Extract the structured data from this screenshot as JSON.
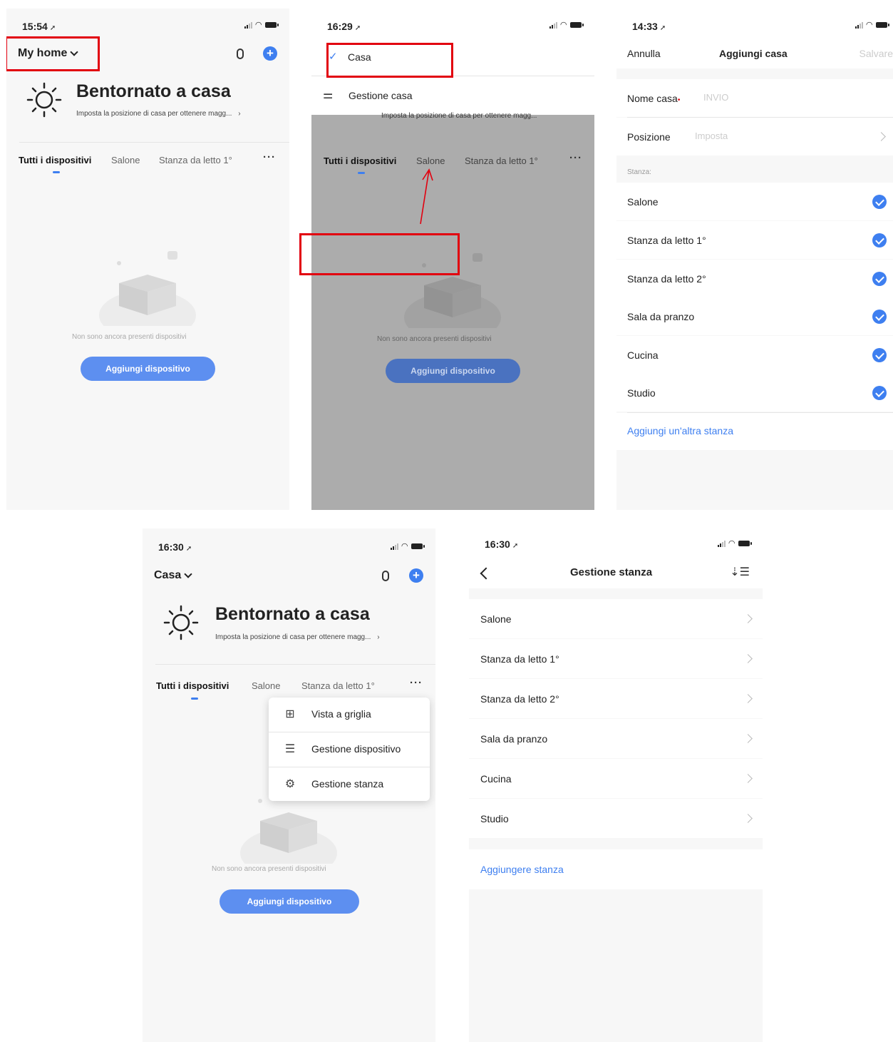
{
  "screen1": {
    "time": "15:54",
    "home_title": "My home",
    "welcome": "Bentornato a casa",
    "subtitle": "Imposta la posizione di casa per ottenere magg...",
    "tabs": [
      "Tutti i dispositivi",
      "Salone",
      "Stanza da letto 1°"
    ],
    "empty_text": "Non sono ancora presenti dispositivi",
    "add_button": "Aggiungi dispositivo"
  },
  "screen2": {
    "time": "16:29",
    "menu_items": [
      "Casa",
      "Gestione casa"
    ],
    "subtitle": "Imposta la posizione di casa per ottenere magg...",
    "tabs": [
      "Tutti i dispositivi",
      "Salone",
      "Stanza da letto 1°"
    ],
    "empty_text": "Non sono ancora presenti dispositivi",
    "add_button": "Aggiungi dispositivo"
  },
  "screen3": {
    "time": "14:33",
    "cancel": "Annulla",
    "title": "Aggiungi casa",
    "save": "Salvare",
    "name_label": "Nome casa",
    "name_placeholder": "INVIO",
    "position_label": "Posizione",
    "position_placeholder": "Imposta",
    "rooms_header": "Stanza:",
    "rooms": [
      "Salone",
      "Stanza da letto 1°",
      "Stanza da letto 2°",
      "Sala da pranzo",
      "Cucina",
      "Studio"
    ],
    "add_room": "Aggiungi un'altra stanza"
  },
  "screen4": {
    "time": "16:30",
    "home_title": "Casa",
    "welcome": "Bentornato a casa",
    "subtitle": "Imposta la posizione di casa per ottenere magg...",
    "tabs": [
      "Tutti i dispositivi",
      "Salone",
      "Stanza da letto 1°"
    ],
    "menu_items": [
      "Vista a griglia",
      "Gestione dispositivo",
      "Gestione stanza"
    ],
    "empty_text": "Non sono ancora presenti dispositivi",
    "add_button": "Aggiungi dispositivo"
  },
  "screen5": {
    "time": "16:30",
    "title": "Gestione stanza",
    "rooms": [
      "Salone",
      "Stanza da letto 1°",
      "Stanza da letto 2°",
      "Sala da pranzo",
      "Cucina",
      "Studio"
    ],
    "add_room": "Aggiungere stanza"
  },
  "colors": {
    "accent": "#3e7ff0",
    "highlight": "#e2000f",
    "background": "#f7f7f7"
  }
}
